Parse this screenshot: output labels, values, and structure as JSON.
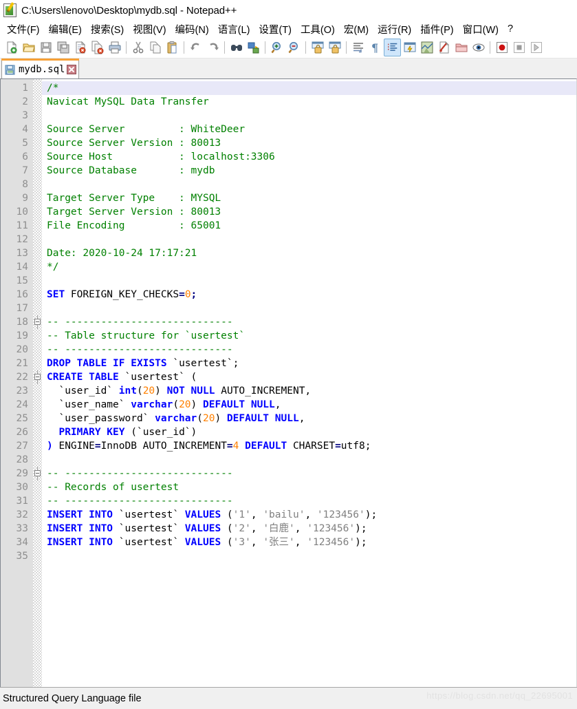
{
  "window": {
    "title": "C:\\Users\\lenovo\\Desktop\\mydb.sql - Notepad++",
    "icon": "notepad-plus-plus-icon"
  },
  "menu": {
    "items": [
      {
        "label": "文件(F)",
        "name": "menu-file"
      },
      {
        "label": "编辑(E)",
        "name": "menu-edit"
      },
      {
        "label": "搜索(S)",
        "name": "menu-search"
      },
      {
        "label": "视图(V)",
        "name": "menu-view"
      },
      {
        "label": "编码(N)",
        "name": "menu-encoding"
      },
      {
        "label": "语言(L)",
        "name": "menu-language"
      },
      {
        "label": "设置(T)",
        "name": "menu-settings"
      },
      {
        "label": "工具(O)",
        "name": "menu-tools"
      },
      {
        "label": "宏(M)",
        "name": "menu-macro"
      },
      {
        "label": "运行(R)",
        "name": "menu-run"
      },
      {
        "label": "插件(P)",
        "name": "menu-plugins"
      },
      {
        "label": "窗口(W)",
        "name": "menu-window"
      },
      {
        "label": "?",
        "name": "menu-help"
      }
    ]
  },
  "toolbar": {
    "buttons": [
      {
        "name": "new-file-icon",
        "tip": "New"
      },
      {
        "name": "open-file-icon",
        "tip": "Open"
      },
      {
        "name": "save-icon",
        "tip": "Save"
      },
      {
        "name": "save-all-icon",
        "tip": "Save All"
      },
      {
        "name": "close-file-icon",
        "tip": "Close"
      },
      {
        "name": "close-all-icon",
        "tip": "Close All"
      },
      {
        "name": "print-icon",
        "tip": "Print"
      },
      {
        "name": "separator",
        "tip": ""
      },
      {
        "name": "cut-icon",
        "tip": "Cut"
      },
      {
        "name": "copy-icon",
        "tip": "Copy"
      },
      {
        "name": "paste-icon",
        "tip": "Paste"
      },
      {
        "name": "separator",
        "tip": ""
      },
      {
        "name": "undo-icon",
        "tip": "Undo"
      },
      {
        "name": "redo-icon",
        "tip": "Redo"
      },
      {
        "name": "separator",
        "tip": ""
      },
      {
        "name": "find-icon",
        "tip": "Find"
      },
      {
        "name": "replace-icon",
        "tip": "Replace"
      },
      {
        "name": "separator",
        "tip": ""
      },
      {
        "name": "zoom-in-icon",
        "tip": "Zoom In"
      },
      {
        "name": "zoom-out-icon",
        "tip": "Zoom Out"
      },
      {
        "name": "separator",
        "tip": ""
      },
      {
        "name": "sync-vertical-scroll-icon",
        "tip": "Sync Vertical Scrolling"
      },
      {
        "name": "sync-horizontal-scroll-icon",
        "tip": "Sync Horizontal Scrolling"
      },
      {
        "name": "separator",
        "tip": ""
      },
      {
        "name": "word-wrap-icon",
        "tip": "Word Wrap"
      },
      {
        "name": "show-all-characters-icon",
        "tip": "Show All Characters"
      },
      {
        "name": "show-indent-guide-icon",
        "tip": "Show Indent Guide",
        "active": true
      },
      {
        "name": "user-defined-dialog-icon",
        "tip": "User Defined Dialogue"
      },
      {
        "name": "document-map-icon",
        "tip": "Document Map"
      },
      {
        "name": "function-list-icon",
        "tip": "Function List"
      },
      {
        "name": "folder-as-workspace-icon",
        "tip": "Folder as Workspace"
      },
      {
        "name": "monitoring-icon",
        "tip": "Monitoring"
      },
      {
        "name": "separator",
        "tip": ""
      },
      {
        "name": "macro-record-icon",
        "tip": "Start Recording"
      },
      {
        "name": "macro-stop-icon",
        "tip": "Stop Recording"
      },
      {
        "name": "macro-play-icon",
        "tip": "Playback"
      }
    ]
  },
  "tabs": [
    {
      "label": "mydb.sql",
      "icon": "saved-file-icon",
      "close": "close-tab-icon",
      "active": true
    }
  ],
  "editor": {
    "current_line": 1,
    "total_lines": 35,
    "fold_lines": [
      18,
      22,
      29
    ],
    "lines": [
      {
        "n": 1,
        "tokens": [
          {
            "t": "/*",
            "c": "cm"
          }
        ]
      },
      {
        "n": 2,
        "tokens": [
          {
            "t": "Navicat MySQL Data Transfer",
            "c": "cm"
          }
        ]
      },
      {
        "n": 3,
        "tokens": []
      },
      {
        "n": 4,
        "tokens": [
          {
            "t": "Source Server         : WhiteDeer",
            "c": "cm"
          }
        ]
      },
      {
        "n": 5,
        "tokens": [
          {
            "t": "Source Server Version : 80013",
            "c": "cm"
          }
        ]
      },
      {
        "n": 6,
        "tokens": [
          {
            "t": "Source Host           : localhost:3306",
            "c": "cm"
          }
        ]
      },
      {
        "n": 7,
        "tokens": [
          {
            "t": "Source Database       : mydb",
            "c": "cm"
          }
        ]
      },
      {
        "n": 8,
        "tokens": []
      },
      {
        "n": 9,
        "tokens": [
          {
            "t": "Target Server Type    : MYSQL",
            "c": "cm"
          }
        ]
      },
      {
        "n": 10,
        "tokens": [
          {
            "t": "Target Server Version : 80013",
            "c": "cm"
          }
        ]
      },
      {
        "n": 11,
        "tokens": [
          {
            "t": "File Encoding         : 65001",
            "c": "cm"
          }
        ]
      },
      {
        "n": 12,
        "tokens": []
      },
      {
        "n": 13,
        "tokens": [
          {
            "t": "Date: 2020-10-24 17:17:21",
            "c": "cm"
          }
        ]
      },
      {
        "n": 14,
        "tokens": [
          {
            "t": "*/",
            "c": "cm"
          }
        ]
      },
      {
        "n": 15,
        "tokens": []
      },
      {
        "n": 16,
        "tokens": [
          {
            "t": "SET",
            "c": "kw"
          },
          {
            "t": " FOREIGN_KEY_CHECKS",
            "c": "pl"
          },
          {
            "t": "=",
            "c": "op"
          },
          {
            "t": "0",
            "c": "num"
          },
          {
            "t": ";",
            "c": "op"
          }
        ]
      },
      {
        "n": 17,
        "tokens": []
      },
      {
        "n": 18,
        "tokens": [
          {
            "t": "-- ----------------------------",
            "c": "cm"
          }
        ]
      },
      {
        "n": 19,
        "tokens": [
          {
            "t": "-- Table structure for `usertest`",
            "c": "cm"
          }
        ]
      },
      {
        "n": 20,
        "tokens": [
          {
            "t": "-- ----------------------------",
            "c": "cm"
          }
        ]
      },
      {
        "n": 21,
        "tokens": [
          {
            "t": "DROP TABLE IF EXISTS",
            "c": "kw"
          },
          {
            "t": " `usertest`;",
            "c": "pl"
          }
        ]
      },
      {
        "n": 22,
        "tokens": [
          {
            "t": "CREATE TABLE",
            "c": "kw"
          },
          {
            "t": " `usertest` (",
            "c": "pl"
          }
        ]
      },
      {
        "n": 23,
        "tokens": [
          {
            "t": "  `user_id` ",
            "c": "pl"
          },
          {
            "t": "int",
            "c": "kw"
          },
          {
            "t": "(",
            "c": "pl"
          },
          {
            "t": "20",
            "c": "num"
          },
          {
            "t": ") ",
            "c": "pl"
          },
          {
            "t": "NOT NULL",
            "c": "kw"
          },
          {
            "t": " AUTO_INCREMENT,",
            "c": "pl"
          }
        ]
      },
      {
        "n": 24,
        "tokens": [
          {
            "t": "  `user_name` ",
            "c": "pl"
          },
          {
            "t": "varchar",
            "c": "kw"
          },
          {
            "t": "(",
            "c": "pl"
          },
          {
            "t": "20",
            "c": "num"
          },
          {
            "t": ") ",
            "c": "pl"
          },
          {
            "t": "DEFAULT NULL",
            "c": "kw"
          },
          {
            "t": ",",
            "c": "pl"
          }
        ]
      },
      {
        "n": 25,
        "tokens": [
          {
            "t": "  `user_password` ",
            "c": "pl"
          },
          {
            "t": "varchar",
            "c": "kw"
          },
          {
            "t": "(",
            "c": "pl"
          },
          {
            "t": "20",
            "c": "num"
          },
          {
            "t": ") ",
            "c": "pl"
          },
          {
            "t": "DEFAULT NULL",
            "c": "kw"
          },
          {
            "t": ",",
            "c": "pl"
          }
        ]
      },
      {
        "n": 26,
        "tokens": [
          {
            "t": "  ",
            "c": "pl"
          },
          {
            "t": "PRIMARY KEY",
            "c": "kw"
          },
          {
            "t": " (`user_id`)",
            "c": "pl"
          }
        ]
      },
      {
        "n": 27,
        "tokens": [
          {
            "t": ")",
            "c": "kw"
          },
          {
            "t": " ENGINE",
            "c": "pl"
          },
          {
            "t": "=",
            "c": "op"
          },
          {
            "t": "InnoDB AUTO_INCREMENT",
            "c": "pl"
          },
          {
            "t": "=",
            "c": "op"
          },
          {
            "t": "4",
            "c": "num"
          },
          {
            "t": " ",
            "c": "pl"
          },
          {
            "t": "DEFAULT",
            "c": "kw"
          },
          {
            "t": " CHARSET",
            "c": "pl"
          },
          {
            "t": "=",
            "c": "op"
          },
          {
            "t": "utf8;",
            "c": "pl"
          }
        ]
      },
      {
        "n": 28,
        "tokens": []
      },
      {
        "n": 29,
        "tokens": [
          {
            "t": "-- ----------------------------",
            "c": "cm"
          }
        ]
      },
      {
        "n": 30,
        "tokens": [
          {
            "t": "-- Records of usertest",
            "c": "cm"
          }
        ]
      },
      {
        "n": 31,
        "tokens": [
          {
            "t": "-- ----------------------------",
            "c": "cm"
          }
        ]
      },
      {
        "n": 32,
        "tokens": [
          {
            "t": "INSERT INTO",
            "c": "kw"
          },
          {
            "t": " `usertest` ",
            "c": "pl"
          },
          {
            "t": "VALUES",
            "c": "kw"
          },
          {
            "t": " (",
            "c": "pl"
          },
          {
            "t": "'1'",
            "c": "str"
          },
          {
            "t": ", ",
            "c": "pl"
          },
          {
            "t": "'bailu'",
            "c": "str"
          },
          {
            "t": ", ",
            "c": "pl"
          },
          {
            "t": "'123456'",
            "c": "str"
          },
          {
            "t": ");",
            "c": "pl"
          }
        ]
      },
      {
        "n": 33,
        "tokens": [
          {
            "t": "INSERT INTO",
            "c": "kw"
          },
          {
            "t": " `usertest` ",
            "c": "pl"
          },
          {
            "t": "VALUES",
            "c": "kw"
          },
          {
            "t": " (",
            "c": "pl"
          },
          {
            "t": "'2'",
            "c": "str"
          },
          {
            "t": ", ",
            "c": "pl"
          },
          {
            "t": "'白鹿'",
            "c": "str"
          },
          {
            "t": ", ",
            "c": "pl"
          },
          {
            "t": "'123456'",
            "c": "str"
          },
          {
            "t": ");",
            "c": "pl"
          }
        ]
      },
      {
        "n": 34,
        "tokens": [
          {
            "t": "INSERT INTO",
            "c": "kw"
          },
          {
            "t": " `usertest` ",
            "c": "pl"
          },
          {
            "t": "VALUES",
            "c": "kw"
          },
          {
            "t": " (",
            "c": "pl"
          },
          {
            "t": "'3'",
            "c": "str"
          },
          {
            "t": ", ",
            "c": "pl"
          },
          {
            "t": "'张三'",
            "c": "str"
          },
          {
            "t": ", ",
            "c": "pl"
          },
          {
            "t": "'123456'",
            "c": "str"
          },
          {
            "t": ");",
            "c": "pl"
          }
        ]
      },
      {
        "n": 35,
        "tokens": []
      }
    ]
  },
  "statusbar": {
    "text": "Structured Query Language file",
    "watermark": "https://blog.csdn.net/qq_22695001"
  },
  "colors": {
    "comment": "#008000",
    "keyword": "#0000ff",
    "number": "#ff8000",
    "string": "#808080",
    "tab_accent": "#f7a036",
    "current_line": "#e8e8f8",
    "gutter": "#e0e0e0"
  }
}
